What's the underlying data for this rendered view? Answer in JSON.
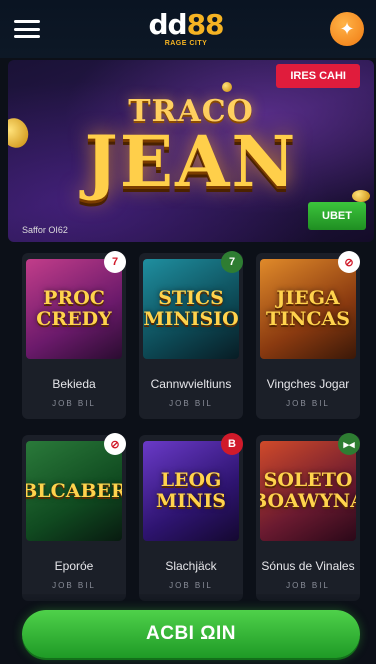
{
  "header": {
    "logo_main_dd": "dd",
    "logo_main_88": "88",
    "logo_tagline": "RAGE CITY"
  },
  "hero": {
    "badge": "IRES CAHI",
    "title_line1": "TRACO",
    "title_line2": "JEAN",
    "subtitle": "Saffor OI62",
    "cta": "UBET"
  },
  "games": [
    {
      "art_text": "PROC CREDY",
      "name": "Bekieda",
      "sub": "JOB BIL",
      "badge_icon": "7",
      "badge_color": "#ffffff",
      "badge_text_color": "#d11a2a",
      "thumb_bg": "linear-gradient(150deg,#c23d8a,#6b1a6b 60%,#2a0c30)"
    },
    {
      "art_text": "STICS MINISIO",
      "name": "Cannwvieltiuns",
      "sub": "JOB BIL",
      "badge_icon": "7",
      "badge_color": "#2e7d32",
      "badge_text_color": "#ffffff",
      "thumb_bg": "linear-gradient(150deg,#1f8fa0,#0d4a56 60%,#081c24)"
    },
    {
      "art_text": "JIEGA TINCAS",
      "name": "Vingches Jogar",
      "sub": "JOB BIL",
      "badge_icon": "⊘",
      "badge_color": "#ffffff",
      "badge_text_color": "#d11a2a",
      "thumb_bg": "linear-gradient(150deg,#e08a2a,#8a3a10 60%,#3a1808)"
    },
    {
      "art_text": "BLCABER",
      "name": "Eporóe",
      "sub": "JOB BIL",
      "badge_icon": "⊘",
      "badge_color": "#ffffff",
      "badge_text_color": "#d11a2a",
      "thumb_bg": "linear-gradient(150deg,#2a7a3a,#104a20 60%,#081a10)"
    },
    {
      "art_text": "LEOG MINIS",
      "name": "Slachjäck",
      "sub": "JOB BIL",
      "badge_icon": "B",
      "badge_color": "#d11a2a",
      "badge_text_color": "#ffffff",
      "thumb_bg": "linear-gradient(150deg,#6a3ac8,#2e1470 60%,#140830)"
    },
    {
      "art_text": "SOLETO BOAWYNA",
      "name": "Sónus de Vinales",
      "sub": "JOB BIL",
      "badge_icon": "▸◂",
      "badge_color": "#2e7d32",
      "badge_text_color": "#ffffff",
      "thumb_bg": "linear-gradient(150deg,#d04a2a,#6a1a30 60%,#2a0818)"
    }
  ],
  "cta_main": "ACBI ΩIN",
  "colors": {
    "accent_gold": "#f5b323",
    "cta_green": "#3cc53c",
    "badge_red": "#e01c3c"
  }
}
